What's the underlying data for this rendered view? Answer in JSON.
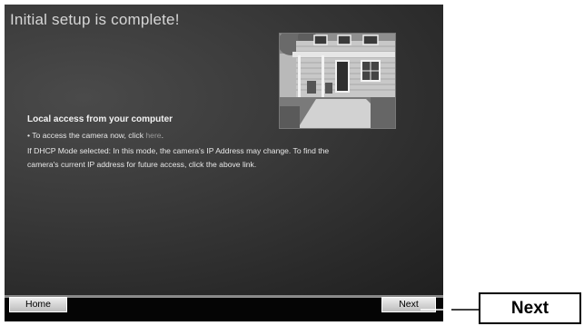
{
  "window": {
    "title": "Initial setup is complete!"
  },
  "content": {
    "section_heading": "Local access from your computer",
    "access_prefix": "• To access the camera now, click ",
    "access_link": "here",
    "access_suffix": ".",
    "dhcp_line1": "If DHCP Mode selected: In this mode, the camera's IP Address may change. To find the",
    "dhcp_line2": "camera's current IP address for future access, click the above link.",
    "photo_icon": "house-photo"
  },
  "footer": {
    "home_label": "Home",
    "next_label": "Next"
  },
  "callout": {
    "label": "Next"
  }
}
